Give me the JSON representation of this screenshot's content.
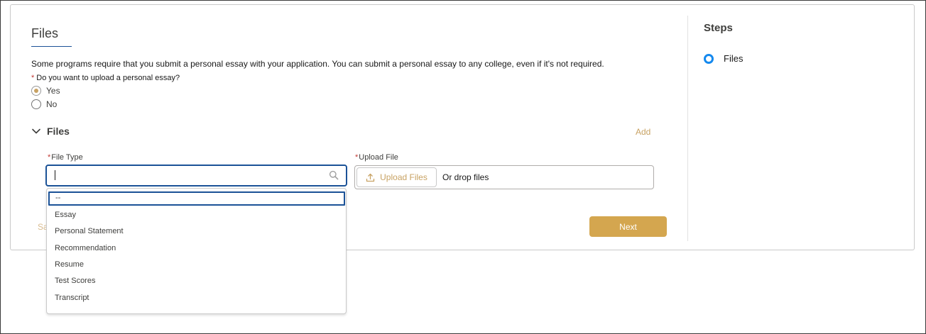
{
  "form": {
    "title": "Files",
    "intro": "Some programs require that you submit a personal essay with your application. You can submit a personal essay to any college, even if it's not required.",
    "required_marker": "*",
    "question": "Do you want to upload a personal essay?",
    "options": [
      {
        "label": "Yes",
        "selected": true
      },
      {
        "label": "No",
        "selected": false
      }
    ],
    "section": {
      "title": "Files",
      "add_label": "Add",
      "file_type_label": "File Type",
      "file_type_value": "",
      "upload_label": "Upload File",
      "upload_button": "Upload Files",
      "drop_text": "Or drop files"
    },
    "save_fragment": "Sa",
    "next_label": "Next"
  },
  "dropdown": {
    "focused_option": "--",
    "options": [
      "Essay",
      "Personal Statement",
      "Recommendation",
      "Resume",
      "Test Scores",
      "Transcript"
    ]
  },
  "steps": {
    "title": "Steps",
    "items": [
      {
        "label": "Files",
        "current": true
      }
    ]
  },
  "colors": {
    "accent_gold": "#d4a64f",
    "link_gold": "#c8a263",
    "focus_blue": "#1b5297",
    "step_blue": "#1589ee",
    "required_red": "#c23934"
  },
  "icons": {
    "chevron": "chevron-down-icon",
    "search": "search-icon",
    "upload": "upload-icon"
  }
}
